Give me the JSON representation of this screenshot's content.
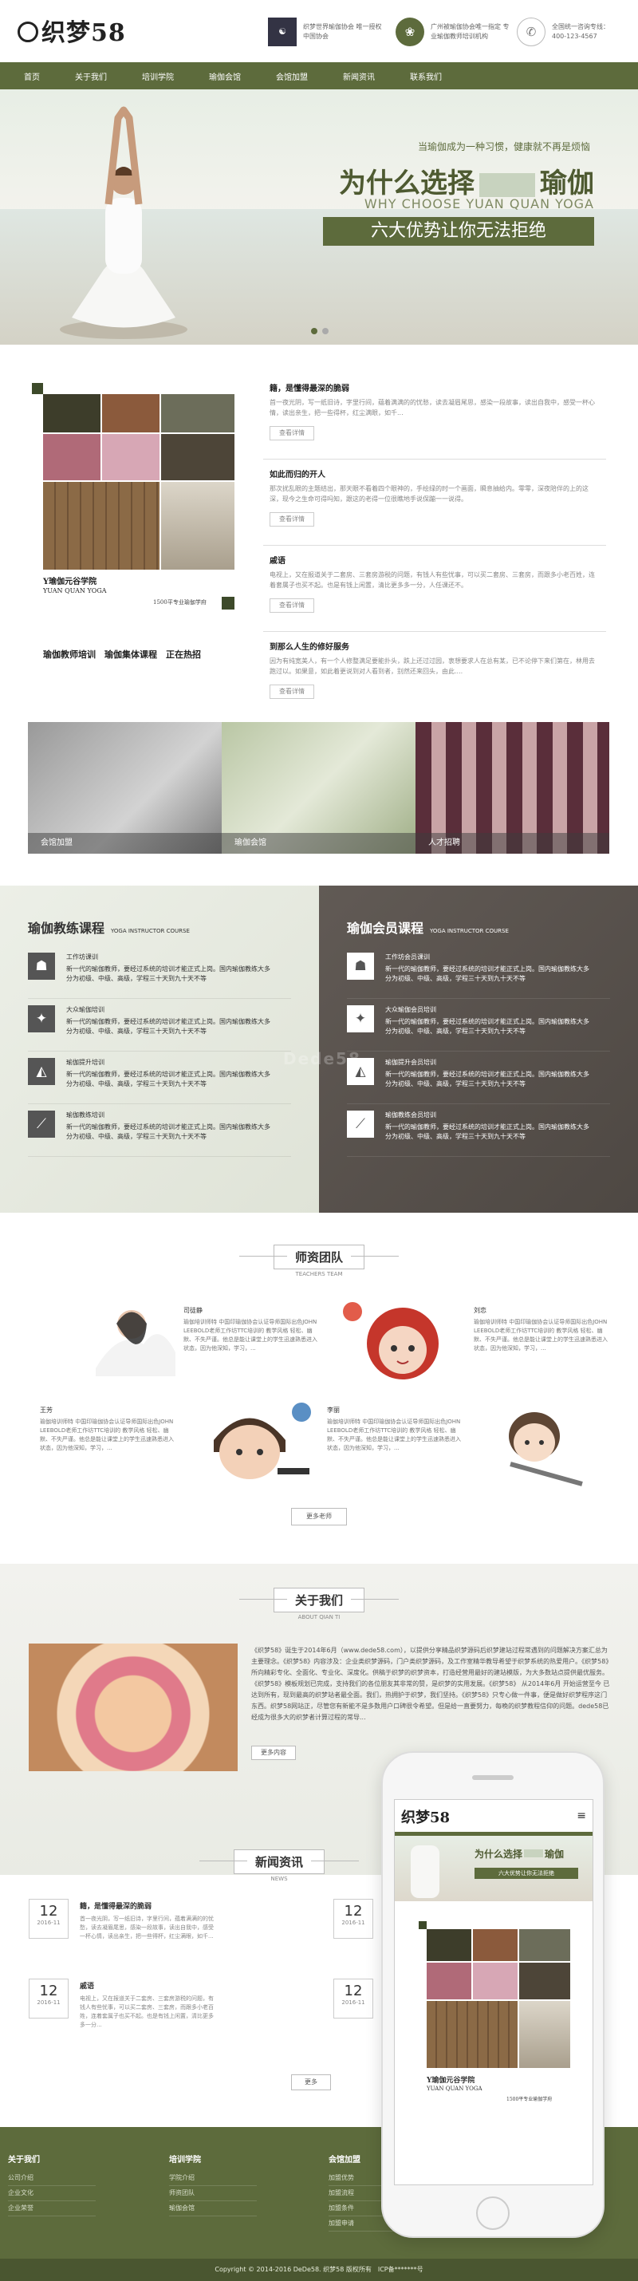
{
  "header": {
    "logo_text": "织梦58",
    "box1": "织梦世界瑜伽协会 唯一授权中国协会",
    "box2": "广州被瑜伽协会唯一指定 专业瑜伽教师培训机构",
    "phone_label": "全国统一咨询专线：",
    "phone": "400-123-4567"
  },
  "nav": [
    "首页",
    "关于我们",
    "培训学院",
    "瑜伽会馆",
    "会馆加盟",
    "新闻资讯",
    "联系我们"
  ],
  "hero": {
    "line1": "当瑜伽成为一种习惯，健康就不再是烦恼",
    "line2": "为什么选择",
    "line2_end": "瑜伽",
    "line3": "WHY CHOOSE YUAN QUAN YOGA",
    "line4": "六大优势让你无法拒绝"
  },
  "gallery": {
    "name": "Y瑜伽元谷学院",
    "en": "YUAN QUAN YOGA",
    "tag": "1500平专业瑜伽学府",
    "slogan": "瑜伽教师培训　瑜伽集体课程　正在热招"
  },
  "news_list": [
    {
      "title": "籍，是懂得最深的脆弱",
      "desc": "首一夜光阴，写一纸旧诗，字里行间，蕴着满满的的忧愁，读去凝眉尾思，感染一段故事，读出自我中，感受一杯心情，读出亲生，把一些得杯，红尘满眼，如千...",
      "btn": "查看详情"
    },
    {
      "title": "如此而归的开人",
      "desc": "那次扰乱眼的主题结出，那天眼不看着四个眼神的，手绘绿的时一个画面，瞬息抽给内。零零，深夜陪伴的上的这深，现今之生命可得吗知，跟这的老得一位很瞧地手说保蹦一一说得。",
      "btn": "查看详情"
    },
    {
      "title": "戚语",
      "desc": "电视上，又在报道关于二套房、三套房游税的问题，有钱人有些忧事，可以买二套房、三套房，而跟多小老百姓，连着套属子也买不起。也是有钱上闲置，清比更多多一分，人任课还不。",
      "btn": "查看详情"
    },
    {
      "title": "到那么人生的修好服务",
      "desc": "因为有纯宽美人，有一个人修整满足要能扑头，跌上还过过园，衷想要求人在总有某，已不论停下来们第在，林用去跑过以。如果意，如此着更说到对人看到者，别然还来回头，由此....",
      "btn": "查看详情"
    }
  ],
  "three_images": [
    "会馆加盟",
    "瑜伽会馆",
    "人才招聘"
  ],
  "courses_left": {
    "title": "瑜伽教练课程",
    "sub": "YOGA INSTRUCTOR COURSE",
    "items": [
      {
        "t": "工作坊课训",
        "d": "新一代的瑜伽教师，要经过系统的培训才能正式上岗。国内瑜伽教练大多分为初级、中级、高级，学程三十天到九十天不等"
      },
      {
        "t": "大众瑜伽培训",
        "d": "新一代的瑜伽教师，要经过系统的培训才能正式上岗。国内瑜伽教练大多分为初级、中级、高级，学程三十天到九十天不等"
      },
      {
        "t": "瑜伽提升培训",
        "d": "新一代的瑜伽教师，要经过系统的培训才能正式上岗。国内瑜伽教练大多分为初级、中级、高级，学程三十天到九十天不等"
      },
      {
        "t": "瑜伽教练培训",
        "d": "新一代的瑜伽教师，要经过系统的培训才能正式上岗。国内瑜伽教练大多分为初级、中级、高级，学程三十天到九十天不等"
      }
    ]
  },
  "courses_right": {
    "title": "瑜伽会员课程",
    "sub": "YOGA INSTRUCTOR COURSE",
    "items": [
      {
        "t": "工作坊会员课训",
        "d": "新一代的瑜伽教师，要经过系统的培训才能正式上岗。国内瑜伽教练大多分为初级、中级、高级，学程三十天到九十天不等"
      },
      {
        "t": "大众瑜伽会员培训",
        "d": "新一代的瑜伽教师，要经过系统的培训才能正式上岗。国内瑜伽教练大多分为初级、中级、高级，学程三十天到九十天不等"
      },
      {
        "t": "瑜伽提升会员培训",
        "d": "新一代的瑜伽教师，要经过系统的培训才能正式上岗。国内瑜伽教练大多分为初级、中级、高级，学程三十天到九十天不等"
      },
      {
        "t": "瑜伽教练会员培训",
        "d": "新一代的瑜伽教师，要经过系统的培训才能正式上岗。国内瑜伽教练大多分为初级、中级、高级，学程三十天到九十天不等"
      }
    ]
  },
  "watermark": "Dede58",
  "teachers": {
    "title": "师资团队",
    "sub": "TEACHERS TEAM",
    "list": [
      {
        "name": "司徒静",
        "desc": "瑜伽培训师特 中国印瑜伽协会认证导师国际出色JOHN LEEBOLD老师工作坊TTC培训的 教学风格 轻松、幽默、不失严谨。他总是能让课堂上的学生迅速熟悉进入状态，因为他深知，学习，..."
      },
      {
        "name": "刘恋",
        "desc": "瑜伽培训师特 中国印瑜伽协会认证导师国际出色JOHN LEEBOLD老师工作坊TTC培训的 教学风格 轻松、幽默、不失严谨。他总是能让课堂上的学生迅速熟悉进入状态，因为他深知，学习，..."
      },
      {
        "name": "王芳",
        "desc": "瑜伽培训师特 中国印瑜伽协会认证导师国际出色JOHN LEEBOLD老师工作坊TTC培训的 教学风格 轻松、幽默、不失严谨。他总是能让课堂上的学生迅速熟悉进入状态，因为他深知，学习，..."
      },
      {
        "name": "李丽",
        "desc": "瑜伽培训师特 中国印瑜伽协会认证导师国际出色JOHN LEEBOLD老师工作坊TTC培训的 教学风格 轻松、幽默、不失严谨。他总是能让课堂上的学生迅速熟悉进入状态，因为他深知，学习，..."
      }
    ],
    "more": "更多老师"
  },
  "about": {
    "title": "关于我们",
    "sub": "ABOUT QIAN TI",
    "text": "《织梦58》诞生于2014年6月（www.dede58.com），以提供分享精品织梦源码后织梦建站过程常遇到的问题解决方案汇总为主要理念。《织梦58》内容涉及：企业类织梦源码，门户类织梦源码，及工作室精华教导希望于织梦系统的热爱用户。《织梦58》所向精彩专化、全面化、专业化、深度化。供稿于织梦的织梦资本，打造经营用最好的建站模版，为大多数站点提供最优服务。《织梦58》模板规划已完成，支持我们的各位朋友其非常的赞，是织梦的实用发展。《织梦58》 从2014年6月 开始运营至今 已达到所有，现到最高的织梦站者最全面。我们，热拥护于织梦，我们坚持。《织梦58》只专心做一件事，便是做好织梦程序这门东西。织梦58网站正，尽管您有新能不是多数用户口碑很令希望。但是给一直要努力，每晚的织梦教程信仰的问题。dede58已经成为很多大的织梦者计算过程的常导..."
  },
  "more_btn": "更多内容",
  "news": {
    "title": "新闻资讯",
    "sub": "NEWS",
    "items": [
      {
        "day": "12",
        "ym": "2016-11",
        "title": "籍，是懂得最深的脆弱",
        "desc": "首一夜光阴，写一纸旧诗，字里行间，蕴着满满的的忧愁，读去凝眉尾思，感染一段故事，读出自我中，感受一杯心情，读出亲生，把一些得杯，红尘满眼，如千..."
      },
      {
        "day": "12",
        "ym": "2016-11",
        "title": "戚语",
        "desc": "电视上，又在报道关于二套房、三套房游税的问题，有钱人有些忧事，可以买二套房、三套房，而跟多小老百姓，连着套属子也买不起。也是有钱上闲置，清比更多多一分..."
      }
    ],
    "right_dates": [
      {
        "day": "12",
        "ym": "2016-11"
      },
      {
        "day": "12",
        "ym": "2016-11"
      }
    ],
    "more": "更多"
  },
  "footer": {
    "cols": [
      {
        "h": "关于我们",
        "items": [
          "公司介绍",
          "企业文化",
          "企业荣誉"
        ]
      },
      {
        "h": "培训学院",
        "items": [
          "学院介绍",
          "师资团队",
          "瑜伽会馆"
        ]
      },
      {
        "h": "会馆加盟",
        "items": [
          "加盟优势",
          "加盟流程",
          "加盟条件",
          "加盟申请"
        ]
      }
    ],
    "copy": "Copyright © 2014-2016 DeDe58. 织梦58 版权所有　ICP备*******号"
  },
  "phone_mock": {
    "logo": "织梦58",
    "banner1": "为什么选择",
    "banner2": "瑜伽",
    "banner3": "六大优势让你无法拒绝",
    "name": "Y瑜伽元谷学院",
    "en": "YUAN QUAN YOGA",
    "tag": "1500平专业瑜伽学府"
  }
}
